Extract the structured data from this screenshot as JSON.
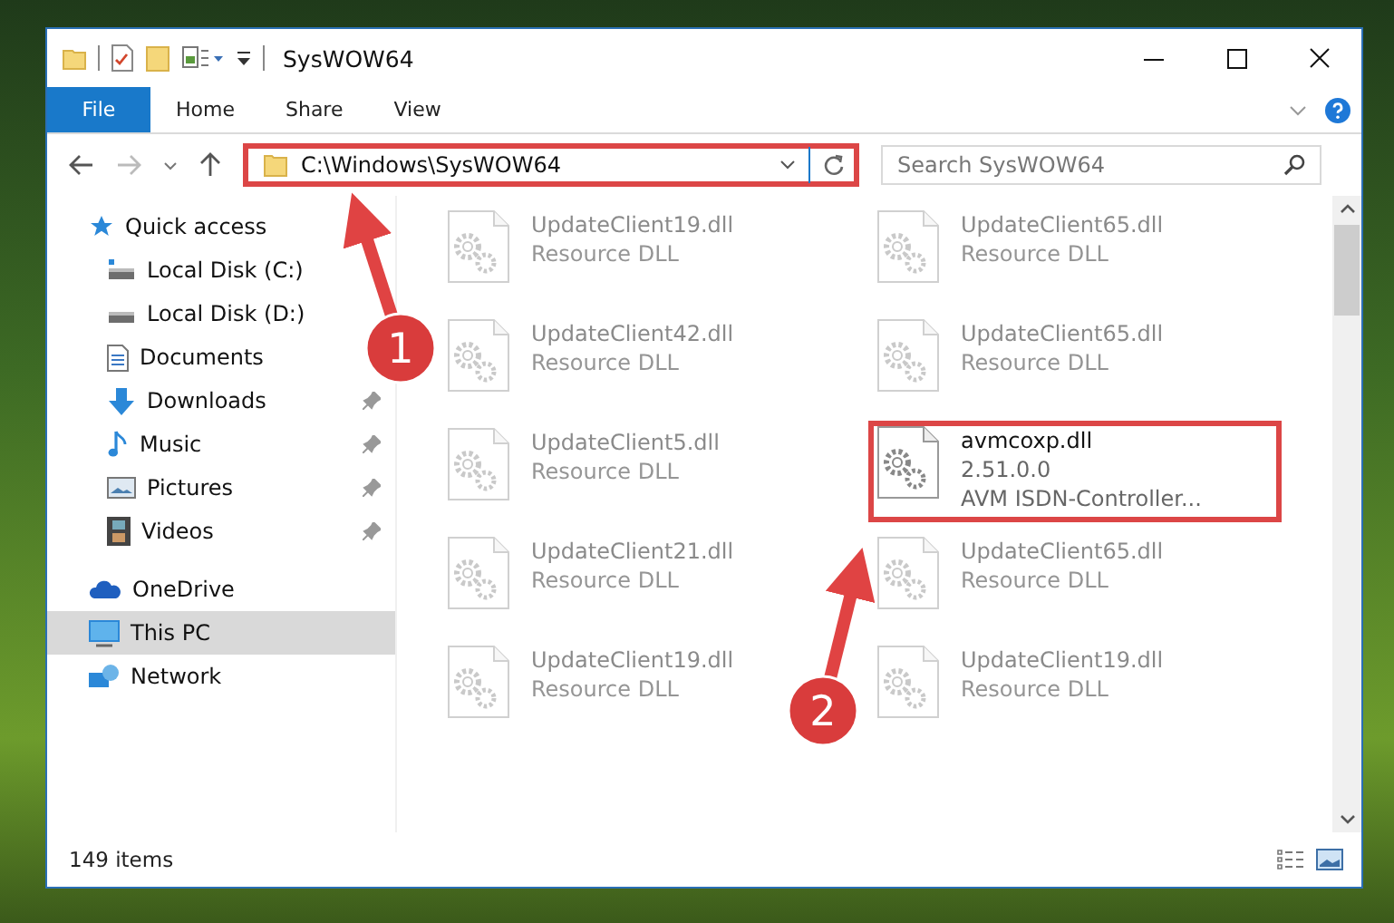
{
  "window": {
    "title": "SysWOW64"
  },
  "ribbon": {
    "file_menu": "File",
    "tabs": [
      {
        "label": "Home",
        "selected": false
      },
      {
        "label": "Share",
        "selected": false
      },
      {
        "label": "View",
        "selected": false
      }
    ]
  },
  "address_bar": {
    "path": "C:\\Windows\\SysWOW64",
    "annotated": true
  },
  "search": {
    "placeholder": "Search SysWOW64"
  },
  "sidebar": {
    "items": [
      {
        "label": "Quick access",
        "kind": "star",
        "selected": false,
        "children": [
          {
            "label": "Local Disk (C:)",
            "kind": "drive-c",
            "pinned": false,
            "selected": false
          },
          {
            "label": "Local Disk (D:)",
            "kind": "drive",
            "pinned": false,
            "selected": false
          },
          {
            "label": "Documents",
            "kind": "document",
            "pinned": false,
            "selected": false
          },
          {
            "label": "Downloads",
            "kind": "download",
            "pinned": true,
            "selected": false
          },
          {
            "label": "Music",
            "kind": "music",
            "pinned": true,
            "selected": false
          },
          {
            "label": "Pictures",
            "kind": "picture",
            "pinned": true,
            "selected": false
          },
          {
            "label": "Videos",
            "kind": "video",
            "pinned": true,
            "selected": false
          }
        ]
      },
      {
        "label": "OneDrive",
        "kind": "cloud",
        "selected": false
      },
      {
        "label": "This PC",
        "kind": "monitor",
        "selected": true
      },
      {
        "label": "Network",
        "kind": "network",
        "selected": false
      }
    ]
  },
  "files": [
    {
      "name": "UpdateClient19.dll",
      "lines": [
        "Resource DLL"
      ],
      "faded": true,
      "annotated": false
    },
    {
      "name": "UpdateClient65.dll",
      "lines": [
        "Resource DLL"
      ],
      "faded": true,
      "annotated": false
    },
    {
      "name": "UpdateClient42.dll",
      "lines": [
        "Resource DLL"
      ],
      "faded": true,
      "annotated": false
    },
    {
      "name": "UpdateClient65.dll",
      "lines": [
        "Resource DLL"
      ],
      "faded": true,
      "annotated": false
    },
    {
      "name": "UpdateClient5.dll",
      "lines": [
        "Resource DLL"
      ],
      "faded": true,
      "annotated": false
    },
    {
      "name": "avmcoxp.dll",
      "lines": [
        "2.51.0.0",
        "AVM ISDN-Controller..."
      ],
      "faded": false,
      "annotated": true
    },
    {
      "name": "UpdateClient21.dll",
      "lines": [
        "Resource DLL"
      ],
      "faded": true,
      "annotated": false
    },
    {
      "name": "UpdateClient65.dll",
      "lines": [
        "Resource DLL"
      ],
      "faded": true,
      "annotated": false
    },
    {
      "name": "UpdateClient19.dll",
      "lines": [
        "Resource DLL"
      ],
      "faded": true,
      "annotated": false
    },
    {
      "name": "UpdateClient19.dll",
      "lines": [
        "Resource DLL"
      ],
      "faded": true,
      "annotated": false
    }
  ],
  "status_bar": {
    "item_count": "149 items"
  },
  "callouts": [
    {
      "number": "1"
    },
    {
      "number": "2"
    }
  ]
}
